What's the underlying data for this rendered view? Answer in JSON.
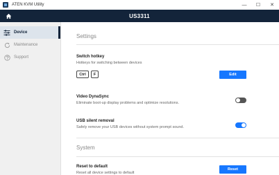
{
  "window": {
    "title": "ATEN KVM Utility",
    "controls": {
      "minimize": "—",
      "maximize": "☐",
      "close": "✕"
    }
  },
  "header": {
    "device_name": "US3311",
    "home_icon": "home-icon"
  },
  "sidebar": {
    "items": [
      {
        "label": "Device",
        "icon": "sliders-icon",
        "active": true
      },
      {
        "label": "Maintenance",
        "icon": "refresh-icon",
        "active": false
      },
      {
        "label": "Support",
        "icon": "question-icon",
        "active": false
      }
    ]
  },
  "settings": {
    "section_title": "Settings",
    "switch_hotkey": {
      "title": "Switch hotkey",
      "description": "Hotkeys for switching between devices",
      "keys": [
        "Ctrl",
        "F"
      ],
      "button_label": "Edit"
    },
    "video_dynasync": {
      "title": "Video DynaSync",
      "description": "Eliminate boot-up display problems and optimize resolutions.",
      "enabled": false
    },
    "usb_silent_removal": {
      "title": "USB silent removal",
      "description": "Safely remove your USB devices without system prompt sound.",
      "enabled": true
    }
  },
  "system": {
    "section_title": "System",
    "reset": {
      "title": "Reset to default",
      "description": "Reset all device settings to default",
      "button_label": "Reset"
    }
  },
  "colors": {
    "header_bg": "#13243a",
    "accent": "#1677ff",
    "toggle_off": "#555555",
    "sidebar_bg": "#f0f0f0"
  }
}
